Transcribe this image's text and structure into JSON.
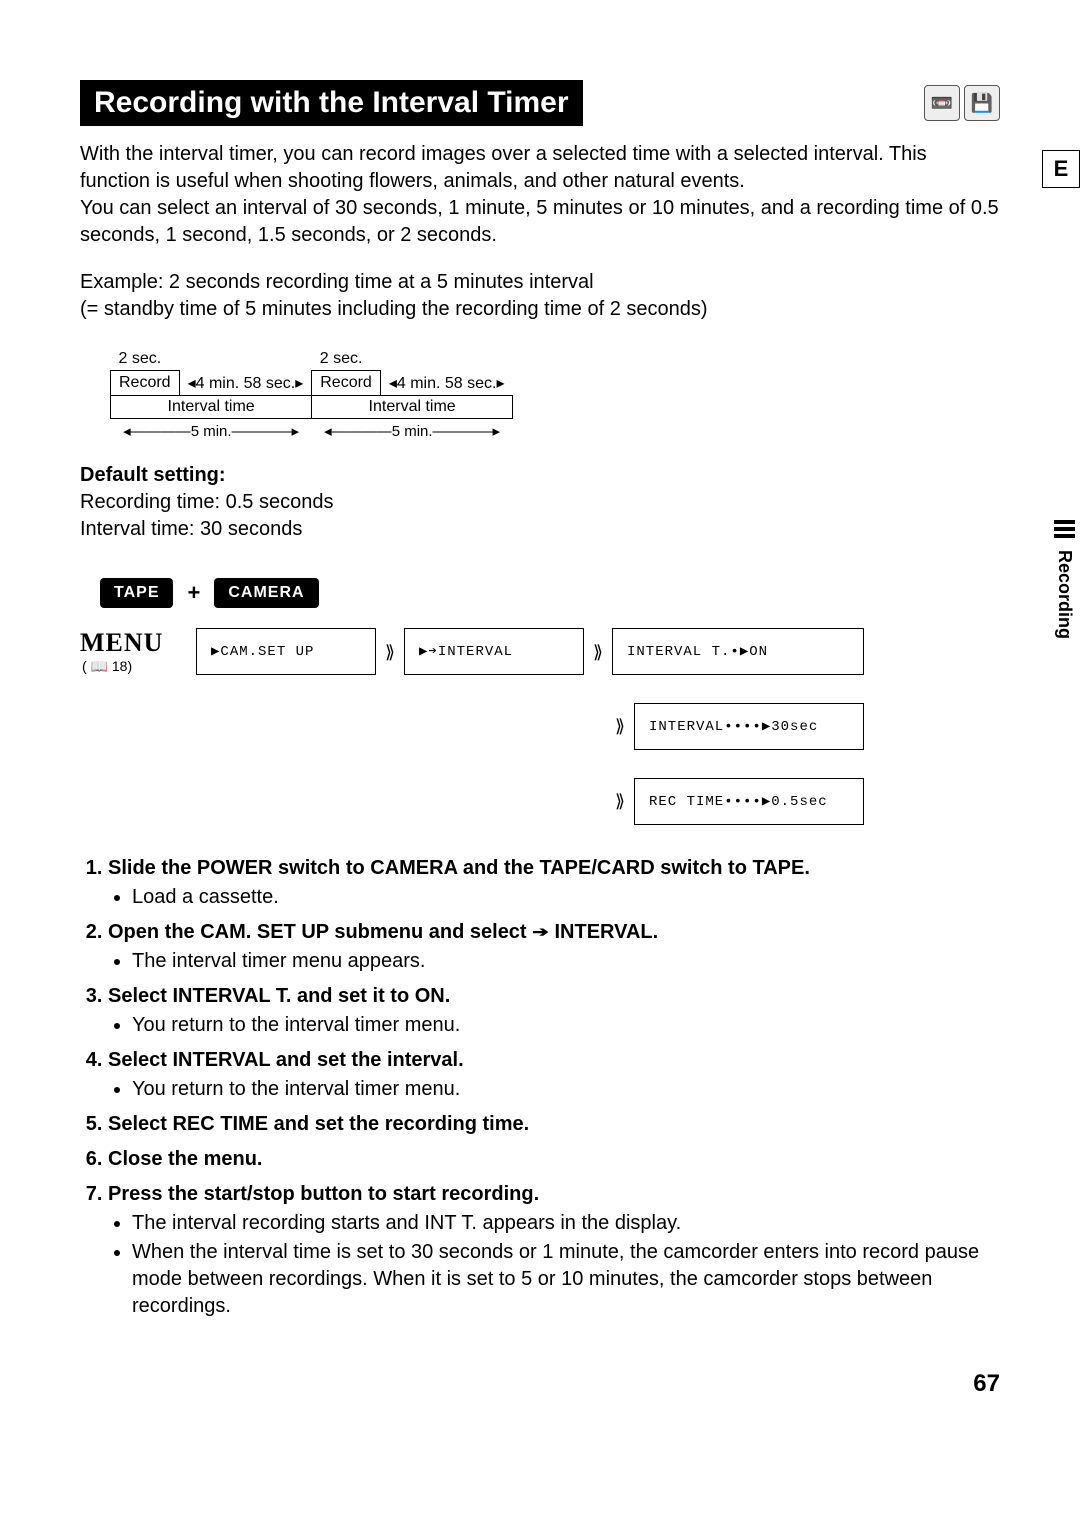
{
  "page": {
    "title": "Recording with the Interval Timer",
    "number": "67",
    "edge_letter": "E",
    "edge_section": "Recording"
  },
  "intro": {
    "p1": "With the interval timer, you can record images over a selected time with a selected interval. This function is useful when shooting flowers, animals, and other natural events.",
    "p2": "You can select an interval of 30 seconds, 1 minute, 5 minutes or 10 minutes, and a recording time of 0.5 seconds, 1 second, 1.5 seconds, or 2 seconds.",
    "example": "Example: 2 seconds recording time at a 5 minutes interval",
    "example_note": "(= standby time of 5 minutes including the recording time of 2 seconds)"
  },
  "diagram": {
    "two_sec": "2 sec.",
    "gap": "4 min. 58 sec.",
    "record": "Record",
    "interval": "Interval time",
    "five_min": "5 min."
  },
  "defaults": {
    "heading": "Default setting:",
    "rec": "Recording time: 0.5 seconds",
    "int": "Interval time: 30 seconds"
  },
  "mode": {
    "tape": "TAPE",
    "camera": "CAMERA"
  },
  "menu": {
    "label": "MENU",
    "page_ref_icon": "📖",
    "page_ref": "18",
    "box1": "▶CAM.SET UP",
    "box2": "▶➔INTERVAL",
    "box3": "INTERVAL T.•▶ON",
    "box4": "INTERVAL••••▶30sec",
    "box5": "REC TIME••••▶0.5sec"
  },
  "steps": {
    "s1": "Slide the POWER switch to CAMERA and the TAPE/CARD switch to TAPE.",
    "s1b": "Load a cassette.",
    "s2a": "Open the CAM. SET UP submenu and select ",
    "s2arrow": "➔",
    "s2b": " INTERVAL.",
    "s2n": "The interval timer menu appears.",
    "s3": "Select INTERVAL T. and set it to ON.",
    "s3n": "You return to the interval timer menu.",
    "s4": "Select INTERVAL and set the interval.",
    "s4n": "You return to the interval timer menu.",
    "s5": "Select REC TIME and set the recording time.",
    "s6": "Close the menu.",
    "s7": "Press the start/stop button to start recording.",
    "s7n1": "The interval recording starts and INT T. appears in the display.",
    "s7n2": "When the interval time is set to 30 seconds or 1 minute, the camcorder enters into record pause mode between recordings. When it is set to 5 or 10 minutes, the camcorder stops between recordings."
  }
}
